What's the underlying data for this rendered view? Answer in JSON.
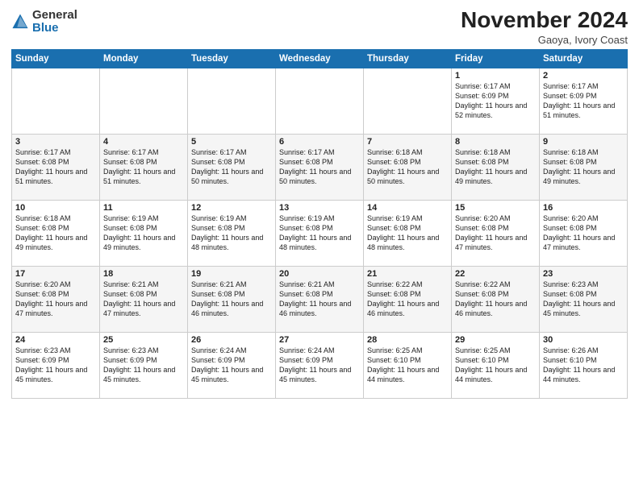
{
  "header": {
    "logo_general": "General",
    "logo_blue": "Blue",
    "month": "November 2024",
    "location": "Gaoya, Ivory Coast"
  },
  "weekdays": [
    "Sunday",
    "Monday",
    "Tuesday",
    "Wednesday",
    "Thursday",
    "Friday",
    "Saturday"
  ],
  "weeks": [
    [
      {
        "day": "",
        "info": ""
      },
      {
        "day": "",
        "info": ""
      },
      {
        "day": "",
        "info": ""
      },
      {
        "day": "",
        "info": ""
      },
      {
        "day": "",
        "info": ""
      },
      {
        "day": "1",
        "info": "Sunrise: 6:17 AM\nSunset: 6:09 PM\nDaylight: 11 hours and 52 minutes."
      },
      {
        "day": "2",
        "info": "Sunrise: 6:17 AM\nSunset: 6:09 PM\nDaylight: 11 hours and 51 minutes."
      }
    ],
    [
      {
        "day": "3",
        "info": "Sunrise: 6:17 AM\nSunset: 6:08 PM\nDaylight: 11 hours and 51 minutes."
      },
      {
        "day": "4",
        "info": "Sunrise: 6:17 AM\nSunset: 6:08 PM\nDaylight: 11 hours and 51 minutes."
      },
      {
        "day": "5",
        "info": "Sunrise: 6:17 AM\nSunset: 6:08 PM\nDaylight: 11 hours and 50 minutes."
      },
      {
        "day": "6",
        "info": "Sunrise: 6:17 AM\nSunset: 6:08 PM\nDaylight: 11 hours and 50 minutes."
      },
      {
        "day": "7",
        "info": "Sunrise: 6:18 AM\nSunset: 6:08 PM\nDaylight: 11 hours and 50 minutes."
      },
      {
        "day": "8",
        "info": "Sunrise: 6:18 AM\nSunset: 6:08 PM\nDaylight: 11 hours and 49 minutes."
      },
      {
        "day": "9",
        "info": "Sunrise: 6:18 AM\nSunset: 6:08 PM\nDaylight: 11 hours and 49 minutes."
      }
    ],
    [
      {
        "day": "10",
        "info": "Sunrise: 6:18 AM\nSunset: 6:08 PM\nDaylight: 11 hours and 49 minutes."
      },
      {
        "day": "11",
        "info": "Sunrise: 6:19 AM\nSunset: 6:08 PM\nDaylight: 11 hours and 49 minutes."
      },
      {
        "day": "12",
        "info": "Sunrise: 6:19 AM\nSunset: 6:08 PM\nDaylight: 11 hours and 48 minutes."
      },
      {
        "day": "13",
        "info": "Sunrise: 6:19 AM\nSunset: 6:08 PM\nDaylight: 11 hours and 48 minutes."
      },
      {
        "day": "14",
        "info": "Sunrise: 6:19 AM\nSunset: 6:08 PM\nDaylight: 11 hours and 48 minutes."
      },
      {
        "day": "15",
        "info": "Sunrise: 6:20 AM\nSunset: 6:08 PM\nDaylight: 11 hours and 47 minutes."
      },
      {
        "day": "16",
        "info": "Sunrise: 6:20 AM\nSunset: 6:08 PM\nDaylight: 11 hours and 47 minutes."
      }
    ],
    [
      {
        "day": "17",
        "info": "Sunrise: 6:20 AM\nSunset: 6:08 PM\nDaylight: 11 hours and 47 minutes."
      },
      {
        "day": "18",
        "info": "Sunrise: 6:21 AM\nSunset: 6:08 PM\nDaylight: 11 hours and 47 minutes."
      },
      {
        "day": "19",
        "info": "Sunrise: 6:21 AM\nSunset: 6:08 PM\nDaylight: 11 hours and 46 minutes."
      },
      {
        "day": "20",
        "info": "Sunrise: 6:21 AM\nSunset: 6:08 PM\nDaylight: 11 hours and 46 minutes."
      },
      {
        "day": "21",
        "info": "Sunrise: 6:22 AM\nSunset: 6:08 PM\nDaylight: 11 hours and 46 minutes."
      },
      {
        "day": "22",
        "info": "Sunrise: 6:22 AM\nSunset: 6:08 PM\nDaylight: 11 hours and 46 minutes."
      },
      {
        "day": "23",
        "info": "Sunrise: 6:23 AM\nSunset: 6:08 PM\nDaylight: 11 hours and 45 minutes."
      }
    ],
    [
      {
        "day": "24",
        "info": "Sunrise: 6:23 AM\nSunset: 6:09 PM\nDaylight: 11 hours and 45 minutes."
      },
      {
        "day": "25",
        "info": "Sunrise: 6:23 AM\nSunset: 6:09 PM\nDaylight: 11 hours and 45 minutes."
      },
      {
        "day": "26",
        "info": "Sunrise: 6:24 AM\nSunset: 6:09 PM\nDaylight: 11 hours and 45 minutes."
      },
      {
        "day": "27",
        "info": "Sunrise: 6:24 AM\nSunset: 6:09 PM\nDaylight: 11 hours and 45 minutes."
      },
      {
        "day": "28",
        "info": "Sunrise: 6:25 AM\nSunset: 6:10 PM\nDaylight: 11 hours and 44 minutes."
      },
      {
        "day": "29",
        "info": "Sunrise: 6:25 AM\nSunset: 6:10 PM\nDaylight: 11 hours and 44 minutes."
      },
      {
        "day": "30",
        "info": "Sunrise: 6:26 AM\nSunset: 6:10 PM\nDaylight: 11 hours and 44 minutes."
      }
    ]
  ]
}
